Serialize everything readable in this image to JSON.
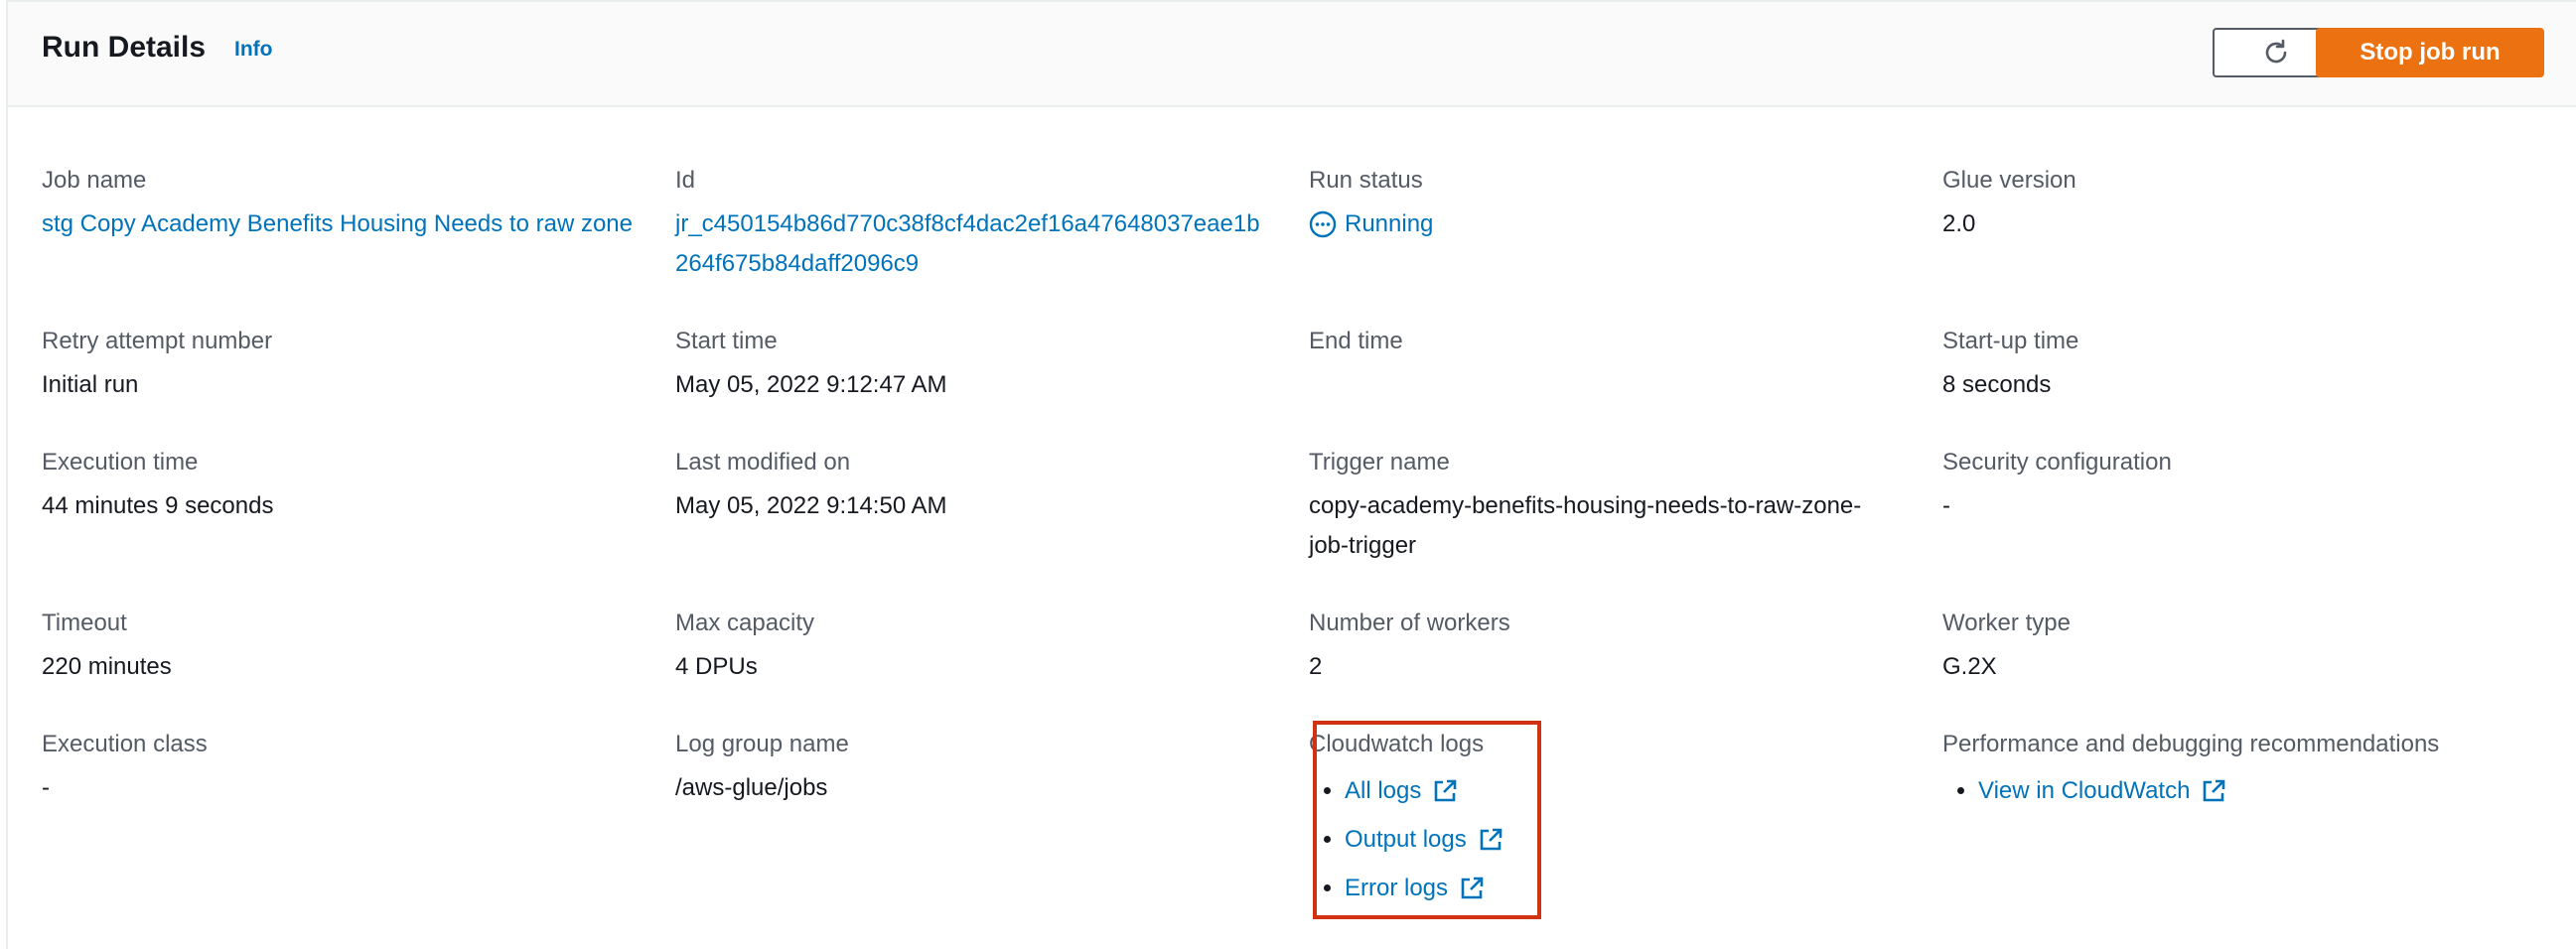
{
  "header": {
    "title": "Run Details",
    "info_label": "Info",
    "stop_label": "Stop job run"
  },
  "fields": {
    "job_name": {
      "label": "Job name",
      "value": "stg Copy Academy Benefits Housing Needs to raw zone"
    },
    "id": {
      "label": "Id",
      "value": "jr_c450154b86d770c38f8cf4dac2ef16a47648037eae1b264f675b84daff2096c9"
    },
    "run_status": {
      "label": "Run status",
      "value": "Running"
    },
    "glue_version": {
      "label": "Glue version",
      "value": "2.0"
    },
    "retry_attempt": {
      "label": "Retry attempt number",
      "value": "Initial run"
    },
    "start_time": {
      "label": "Start time",
      "value": "May 05, 2022 9:12:47 AM"
    },
    "end_time": {
      "label": "End time",
      "value": ""
    },
    "startup_time": {
      "label": "Start-up time",
      "value": "8 seconds"
    },
    "execution_time": {
      "label": "Execution time",
      "value": "44 minutes 9 seconds"
    },
    "last_modified": {
      "label": "Last modified on",
      "value": "May 05, 2022 9:14:50 AM"
    },
    "trigger_name": {
      "label": "Trigger name",
      "value": "copy-academy-benefits-housing-needs-to-raw-zone-job-trigger"
    },
    "security_config": {
      "label": "Security configuration",
      "value": "-"
    },
    "timeout": {
      "label": "Timeout",
      "value": "220 minutes"
    },
    "max_capacity": {
      "label": "Max capacity",
      "value": "4 DPUs"
    },
    "num_workers": {
      "label": "Number of workers",
      "value": "2"
    },
    "worker_type": {
      "label": "Worker type",
      "value": "G.2X"
    },
    "execution_class": {
      "label": "Execution class",
      "value": "-"
    },
    "log_group": {
      "label": "Log group name",
      "value": "/aws-glue/jobs"
    },
    "cloudwatch_logs": {
      "label": "Cloudwatch logs",
      "links": [
        "All logs",
        "Output logs",
        "Error logs"
      ]
    },
    "perf_recommendations": {
      "label": "Performance and debugging recommendations",
      "links": [
        "View in CloudWatch"
      ]
    }
  },
  "icons": {
    "refresh": "refresh-icon",
    "status": "in-progress-icon",
    "external": "external-link-icon"
  },
  "colors": {
    "accent": "#ec7211",
    "link": "#0073bb",
    "highlight": "#d13212"
  }
}
